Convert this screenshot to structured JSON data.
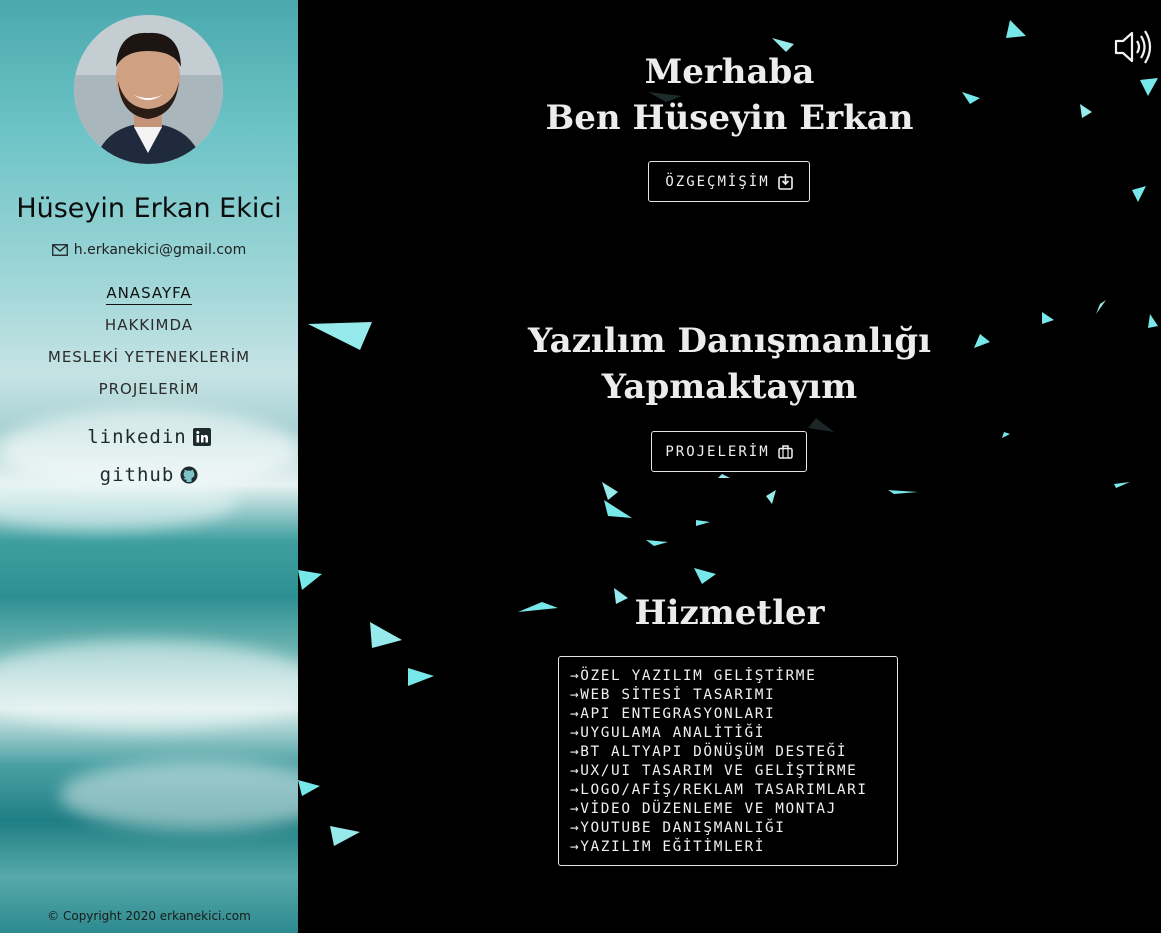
{
  "sidebar": {
    "name": "Hüseyin Erkan Ekici",
    "email": "h.erkanekici@gmail.com",
    "nav": [
      {
        "label": "ANASAYFA",
        "active": true
      },
      {
        "label": "HAKKIMDA",
        "active": false
      },
      {
        "label": "MESLEKİ YETENEKLERİM",
        "active": false
      },
      {
        "label": "PROJELERİM",
        "active": false
      }
    ],
    "social": [
      {
        "label": "linkedin",
        "icon": "linkedin-icon"
      },
      {
        "label": "github",
        "icon": "github-icon"
      }
    ],
    "copyright": "© Copyright 2020 erkanekici.com"
  },
  "main": {
    "hero": {
      "line1": "Merhaba",
      "line2": "Ben Hüseyin Erkan",
      "button": "ÖZGEÇMİŞİM",
      "button_icon": "download-icon"
    },
    "consulting": {
      "line1": "Yazılım Danışmanlığı",
      "line2": "Yapmaktayım",
      "button": "PROJELERİM",
      "button_icon": "briefcase-icon"
    },
    "services": {
      "title": "Hizmetler",
      "items": [
        "→ÖZEL YAZILIM GELİŞTİRME",
        "→WEB SİTESİ TASARIMI",
        "→API ENTEGRASYONLARI",
        "→UYGULAMA ANALİTİĞİ",
        "→BT ALTYAPI DÖNÜŞÜM DESTEĞİ",
        "→UX/UI TASARIM VE GELİŞTİRME",
        "→LOGO/AFİŞ/REKLAM TASARIMLARI",
        "→VİDEO DÜZENLEME VE MONTAJ",
        "→YOUTUBE DANIŞMANLIĞI",
        "→YAZILIM EĞİTİMLERİ"
      ]
    },
    "sound_icon": "speaker-icon"
  },
  "colors": {
    "background": "#000000",
    "shard": "#7ef3f6",
    "text": "#ececec",
    "sidebar_water": "#3f9fa0"
  }
}
